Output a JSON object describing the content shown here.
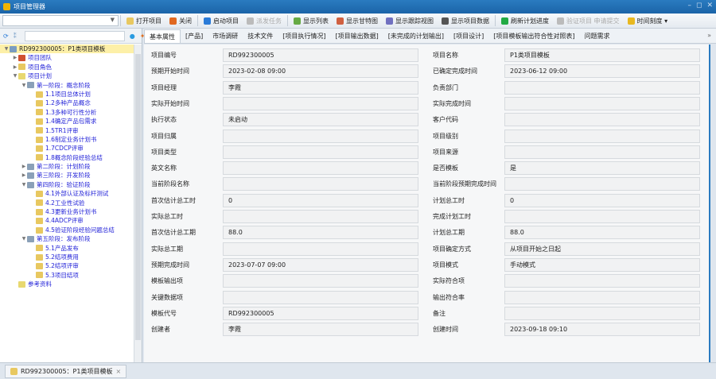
{
  "window": {
    "title": "项目管理器"
  },
  "toolbar": {
    "items": [
      {
        "label": "打开项目",
        "icon": "folder-open-icon",
        "color": "#e8c860",
        "disabled": false
      },
      {
        "label": "关闭",
        "icon": "close-project-icon",
        "color": "#e06820",
        "disabled": false
      },
      {
        "label": "启动项目",
        "icon": "start-icon",
        "color": "#2a7bd8",
        "disabled": false
      },
      {
        "label": "派发任务",
        "icon": "dispatch-icon",
        "color": "#bbbbbb",
        "disabled": true
      },
      {
        "label": "显示列表",
        "icon": "list-icon",
        "color": "#66aa44",
        "disabled": false
      },
      {
        "label": "显示甘特图",
        "icon": "gantt-icon",
        "color": "#d06040",
        "disabled": false
      },
      {
        "label": "显示跟踪视图",
        "icon": "tracking-view-icon",
        "color": "#7070c0",
        "disabled": false
      },
      {
        "label": "显示项目数据",
        "icon": "project-data-icon",
        "color": "#555555",
        "disabled": false
      },
      {
        "label": "刷新计划进度",
        "icon": "refresh-icon",
        "color": "#22aa44",
        "disabled": false
      },
      {
        "label": "验证项目 申请提交",
        "icon": "verify-icon",
        "color": "#bbbbbb",
        "disabled": true
      },
      {
        "label": "时间刻度 ▾",
        "icon": "clock-icon",
        "color": "#e8b820",
        "disabled": false
      }
    ]
  },
  "tabs": [
    "基本属性",
    "[产品]",
    "市场调研",
    "技术文件",
    "[项目执行情况]",
    "[项目输出数据]",
    "[未完成的计划输出]",
    "[项目设计]",
    "[项目模板输出符合性对照表]",
    "问题需求"
  ],
  "tree": [
    {
      "label": "RD992300005：P1类项目模板",
      "level": 0,
      "toggle": "▼",
      "icon": "#7a9cc0",
      "root": true
    },
    {
      "label": "项目团队",
      "level": 1,
      "toggle": "▶",
      "icon": "#d05030"
    },
    {
      "label": "项目角色",
      "level": 1,
      "toggle": "▶",
      "icon": "#e8c860"
    },
    {
      "label": "项目计划",
      "level": 1,
      "toggle": "▼",
      "icon": "#e8d870"
    },
    {
      "label": "第一阶段：概念阶段",
      "level": 2,
      "toggle": "▼",
      "icon": "#8aa0b8"
    },
    {
      "label": "1.1项目总体计划",
      "level": 3,
      "toggle": "",
      "icon": "#e8c860"
    },
    {
      "label": "1.2多种产品概念",
      "level": 3,
      "toggle": "",
      "icon": "#e8c860"
    },
    {
      "label": "1.3多种可行性分析",
      "level": 3,
      "toggle": "",
      "icon": "#e8c860"
    },
    {
      "label": "1.4确定产品包需求",
      "level": 3,
      "toggle": "",
      "icon": "#e8c860"
    },
    {
      "label": "1.5TR1评审",
      "level": 3,
      "toggle": "",
      "icon": "#e8c860"
    },
    {
      "label": "1.6制定业务计划书",
      "level": 3,
      "toggle": "",
      "icon": "#e8c860"
    },
    {
      "label": "1.7CDCP评审",
      "level": 3,
      "toggle": "",
      "icon": "#e8c860"
    },
    {
      "label": "1.8概念阶段经验总结",
      "level": 3,
      "toggle": "",
      "icon": "#e8c860"
    },
    {
      "label": "第二阶段：计划阶段",
      "level": 2,
      "toggle": "▶",
      "icon": "#8aa0b8"
    },
    {
      "label": "第三阶段：开发阶段",
      "level": 2,
      "toggle": "▶",
      "icon": "#8aa0b8"
    },
    {
      "label": "第四阶段：验证阶段",
      "level": 2,
      "toggle": "▼",
      "icon": "#8aa0b8"
    },
    {
      "label": "4.1外部认证及标杆测试",
      "level": 3,
      "toggle": "",
      "icon": "#e8c860"
    },
    {
      "label": "4.2工业性试验",
      "level": 3,
      "toggle": "",
      "icon": "#e8c860"
    },
    {
      "label": "4.3更新业务计划书",
      "level": 3,
      "toggle": "",
      "icon": "#e8c860"
    },
    {
      "label": "4.4ADCP评审",
      "level": 3,
      "toggle": "",
      "icon": "#e8c860"
    },
    {
      "label": "4.5验证阶段经验问题总结",
      "level": 3,
      "toggle": "",
      "icon": "#e8c860"
    },
    {
      "label": "第五阶段：发布阶段",
      "level": 2,
      "toggle": "▼",
      "icon": "#8aa0b8"
    },
    {
      "label": "5.1产品发布",
      "level": 3,
      "toggle": "",
      "icon": "#e8c860"
    },
    {
      "label": "5.2结项费用",
      "level": 3,
      "toggle": "",
      "icon": "#e8c860"
    },
    {
      "label": "5.2结项评审",
      "level": 3,
      "toggle": "",
      "icon": "#e8c860"
    },
    {
      "label": "5.3项目结项",
      "level": 3,
      "toggle": "",
      "icon": "#e8c860"
    },
    {
      "label": "参考资料",
      "level": 1,
      "toggle": "",
      "icon": "#e8d870"
    }
  ],
  "form": {
    "left": [
      {
        "label": "项目编号",
        "value": "RD992300005"
      },
      {
        "label": "预期开始时间",
        "value": "2023-02-08 09:00"
      },
      {
        "label": "项目经理",
        "value": "李霞"
      },
      {
        "label": "实际开始时间",
        "value": ""
      },
      {
        "label": "执行状态",
        "value": "未启动"
      },
      {
        "label": "项目归属",
        "value": ""
      },
      {
        "label": "项目类型",
        "value": ""
      },
      {
        "label": "英文名称",
        "value": ""
      },
      {
        "label": "当前阶段名称",
        "value": ""
      },
      {
        "label": "首次估计总工时",
        "value": "0"
      },
      {
        "label": "实际总工时",
        "value": ""
      },
      {
        "label": "首次估计总工期",
        "value": "88.0"
      },
      {
        "label": "实际总工期",
        "value": ""
      },
      {
        "label": "预期完成时间",
        "value": "2023-07-07 09:00"
      },
      {
        "label": "模板输出项",
        "value": ""
      },
      {
        "label": "关键数据项",
        "value": ""
      },
      {
        "label": "模板代号",
        "value": "RD992300005"
      },
      {
        "label": "创建者",
        "value": "李霞"
      }
    ],
    "right": [
      {
        "label": "项目名称",
        "value": "P1类项目模板"
      },
      {
        "label": "已确定完成时间",
        "value": "2023-06-12 09:00"
      },
      {
        "label": "负责部门",
        "value": ""
      },
      {
        "label": "实际完成时间",
        "value": ""
      },
      {
        "label": "客户代码",
        "value": ""
      },
      {
        "label": "项目级别",
        "value": ""
      },
      {
        "label": "项目来源",
        "value": ""
      },
      {
        "label": "是否模板",
        "value": "是"
      },
      {
        "label": "当前阶段预期完成时间",
        "value": ""
      },
      {
        "label": "计划总工时",
        "value": "0"
      },
      {
        "label": "完成计划工时",
        "value": ""
      },
      {
        "label": "计划总工期",
        "value": "88.0"
      },
      {
        "label": "项目确定方式",
        "value": "从项目开始之日起"
      },
      {
        "label": "项目模式",
        "value": "手动模式"
      },
      {
        "label": "实际符合项",
        "value": ""
      },
      {
        "label": "输出符合率",
        "value": ""
      },
      {
        "label": "备注",
        "value": ""
      },
      {
        "label": "创建时间",
        "value": "2023-09-18 09:10"
      }
    ]
  },
  "bottom_tab": {
    "label": "RD992300005：P1类项目模板",
    "close": "×"
  }
}
